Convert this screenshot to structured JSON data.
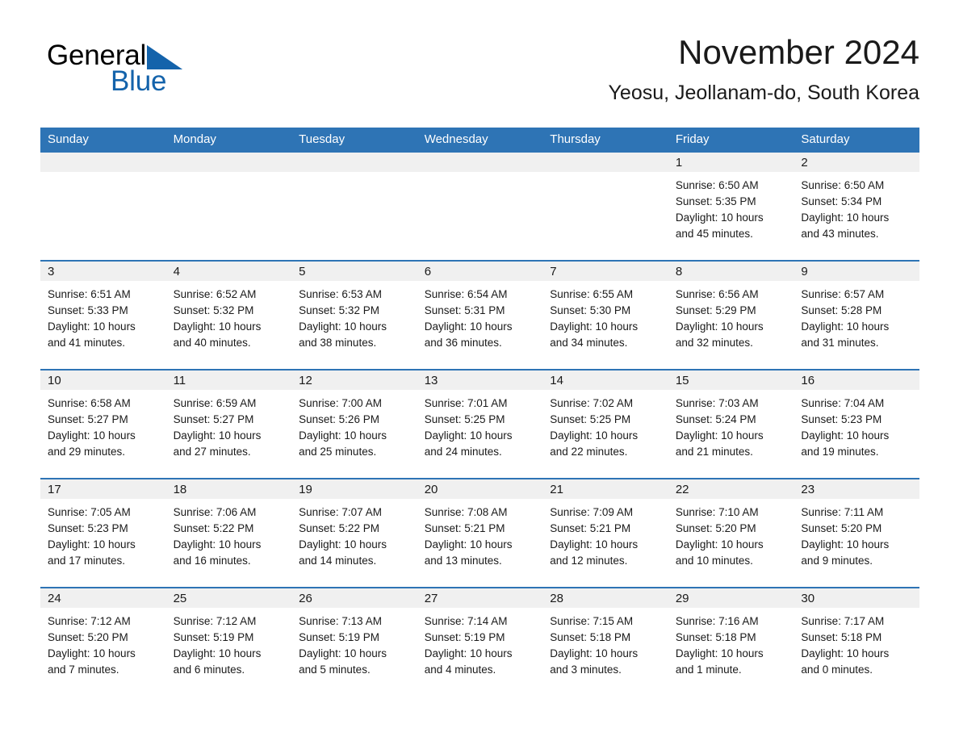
{
  "brand": {
    "name_part1": "General",
    "name_part2": "Blue",
    "logo_icon": "triangle-icon",
    "accent_color": "#1463ab"
  },
  "header": {
    "title": "November 2024",
    "subtitle": "Yeosu, Jeollanam-do, South Korea"
  },
  "theme": {
    "header_blue": "#2e74b5",
    "day_band_gray": "#f0f0f0",
    "text_color": "#1a1a1a"
  },
  "weekdays": [
    "Sunday",
    "Monday",
    "Tuesday",
    "Wednesday",
    "Thursday",
    "Friday",
    "Saturday"
  ],
  "weeks": [
    [
      {
        "day": "",
        "sunrise": "",
        "sunset": "",
        "daylight1": "",
        "daylight2": ""
      },
      {
        "day": "",
        "sunrise": "",
        "sunset": "",
        "daylight1": "",
        "daylight2": ""
      },
      {
        "day": "",
        "sunrise": "",
        "sunset": "",
        "daylight1": "",
        "daylight2": ""
      },
      {
        "day": "",
        "sunrise": "",
        "sunset": "",
        "daylight1": "",
        "daylight2": ""
      },
      {
        "day": "",
        "sunrise": "",
        "sunset": "",
        "daylight1": "",
        "daylight2": ""
      },
      {
        "day": "1",
        "sunrise": "Sunrise: 6:50 AM",
        "sunset": "Sunset: 5:35 PM",
        "daylight1": "Daylight: 10 hours",
        "daylight2": "and 45 minutes."
      },
      {
        "day": "2",
        "sunrise": "Sunrise: 6:50 AM",
        "sunset": "Sunset: 5:34 PM",
        "daylight1": "Daylight: 10 hours",
        "daylight2": "and 43 minutes."
      }
    ],
    [
      {
        "day": "3",
        "sunrise": "Sunrise: 6:51 AM",
        "sunset": "Sunset: 5:33 PM",
        "daylight1": "Daylight: 10 hours",
        "daylight2": "and 41 minutes."
      },
      {
        "day": "4",
        "sunrise": "Sunrise: 6:52 AM",
        "sunset": "Sunset: 5:32 PM",
        "daylight1": "Daylight: 10 hours",
        "daylight2": "and 40 minutes."
      },
      {
        "day": "5",
        "sunrise": "Sunrise: 6:53 AM",
        "sunset": "Sunset: 5:32 PM",
        "daylight1": "Daylight: 10 hours",
        "daylight2": "and 38 minutes."
      },
      {
        "day": "6",
        "sunrise": "Sunrise: 6:54 AM",
        "sunset": "Sunset: 5:31 PM",
        "daylight1": "Daylight: 10 hours",
        "daylight2": "and 36 minutes."
      },
      {
        "day": "7",
        "sunrise": "Sunrise: 6:55 AM",
        "sunset": "Sunset: 5:30 PM",
        "daylight1": "Daylight: 10 hours",
        "daylight2": "and 34 minutes."
      },
      {
        "day": "8",
        "sunrise": "Sunrise: 6:56 AM",
        "sunset": "Sunset: 5:29 PM",
        "daylight1": "Daylight: 10 hours",
        "daylight2": "and 32 minutes."
      },
      {
        "day": "9",
        "sunrise": "Sunrise: 6:57 AM",
        "sunset": "Sunset: 5:28 PM",
        "daylight1": "Daylight: 10 hours",
        "daylight2": "and 31 minutes."
      }
    ],
    [
      {
        "day": "10",
        "sunrise": "Sunrise: 6:58 AM",
        "sunset": "Sunset: 5:27 PM",
        "daylight1": "Daylight: 10 hours",
        "daylight2": "and 29 minutes."
      },
      {
        "day": "11",
        "sunrise": "Sunrise: 6:59 AM",
        "sunset": "Sunset: 5:27 PM",
        "daylight1": "Daylight: 10 hours",
        "daylight2": "and 27 minutes."
      },
      {
        "day": "12",
        "sunrise": "Sunrise: 7:00 AM",
        "sunset": "Sunset: 5:26 PM",
        "daylight1": "Daylight: 10 hours",
        "daylight2": "and 25 minutes."
      },
      {
        "day": "13",
        "sunrise": "Sunrise: 7:01 AM",
        "sunset": "Sunset: 5:25 PM",
        "daylight1": "Daylight: 10 hours",
        "daylight2": "and 24 minutes."
      },
      {
        "day": "14",
        "sunrise": "Sunrise: 7:02 AM",
        "sunset": "Sunset: 5:25 PM",
        "daylight1": "Daylight: 10 hours",
        "daylight2": "and 22 minutes."
      },
      {
        "day": "15",
        "sunrise": "Sunrise: 7:03 AM",
        "sunset": "Sunset: 5:24 PM",
        "daylight1": "Daylight: 10 hours",
        "daylight2": "and 21 minutes."
      },
      {
        "day": "16",
        "sunrise": "Sunrise: 7:04 AM",
        "sunset": "Sunset: 5:23 PM",
        "daylight1": "Daylight: 10 hours",
        "daylight2": "and 19 minutes."
      }
    ],
    [
      {
        "day": "17",
        "sunrise": "Sunrise: 7:05 AM",
        "sunset": "Sunset: 5:23 PM",
        "daylight1": "Daylight: 10 hours",
        "daylight2": "and 17 minutes."
      },
      {
        "day": "18",
        "sunrise": "Sunrise: 7:06 AM",
        "sunset": "Sunset: 5:22 PM",
        "daylight1": "Daylight: 10 hours",
        "daylight2": "and 16 minutes."
      },
      {
        "day": "19",
        "sunrise": "Sunrise: 7:07 AM",
        "sunset": "Sunset: 5:22 PM",
        "daylight1": "Daylight: 10 hours",
        "daylight2": "and 14 minutes."
      },
      {
        "day": "20",
        "sunrise": "Sunrise: 7:08 AM",
        "sunset": "Sunset: 5:21 PM",
        "daylight1": "Daylight: 10 hours",
        "daylight2": "and 13 minutes."
      },
      {
        "day": "21",
        "sunrise": "Sunrise: 7:09 AM",
        "sunset": "Sunset: 5:21 PM",
        "daylight1": "Daylight: 10 hours",
        "daylight2": "and 12 minutes."
      },
      {
        "day": "22",
        "sunrise": "Sunrise: 7:10 AM",
        "sunset": "Sunset: 5:20 PM",
        "daylight1": "Daylight: 10 hours",
        "daylight2": "and 10 minutes."
      },
      {
        "day": "23",
        "sunrise": "Sunrise: 7:11 AM",
        "sunset": "Sunset: 5:20 PM",
        "daylight1": "Daylight: 10 hours",
        "daylight2": "and 9 minutes."
      }
    ],
    [
      {
        "day": "24",
        "sunrise": "Sunrise: 7:12 AM",
        "sunset": "Sunset: 5:20 PM",
        "daylight1": "Daylight: 10 hours",
        "daylight2": "and 7 minutes."
      },
      {
        "day": "25",
        "sunrise": "Sunrise: 7:12 AM",
        "sunset": "Sunset: 5:19 PM",
        "daylight1": "Daylight: 10 hours",
        "daylight2": "and 6 minutes."
      },
      {
        "day": "26",
        "sunrise": "Sunrise: 7:13 AM",
        "sunset": "Sunset: 5:19 PM",
        "daylight1": "Daylight: 10 hours",
        "daylight2": "and 5 minutes."
      },
      {
        "day": "27",
        "sunrise": "Sunrise: 7:14 AM",
        "sunset": "Sunset: 5:19 PM",
        "daylight1": "Daylight: 10 hours",
        "daylight2": "and 4 minutes."
      },
      {
        "day": "28",
        "sunrise": "Sunrise: 7:15 AM",
        "sunset": "Sunset: 5:18 PM",
        "daylight1": "Daylight: 10 hours",
        "daylight2": "and 3 minutes."
      },
      {
        "day": "29",
        "sunrise": "Sunrise: 7:16 AM",
        "sunset": "Sunset: 5:18 PM",
        "daylight1": "Daylight: 10 hours",
        "daylight2": "and 1 minute."
      },
      {
        "day": "30",
        "sunrise": "Sunrise: 7:17 AM",
        "sunset": "Sunset: 5:18 PM",
        "daylight1": "Daylight: 10 hours",
        "daylight2": "and 0 minutes."
      }
    ]
  ]
}
